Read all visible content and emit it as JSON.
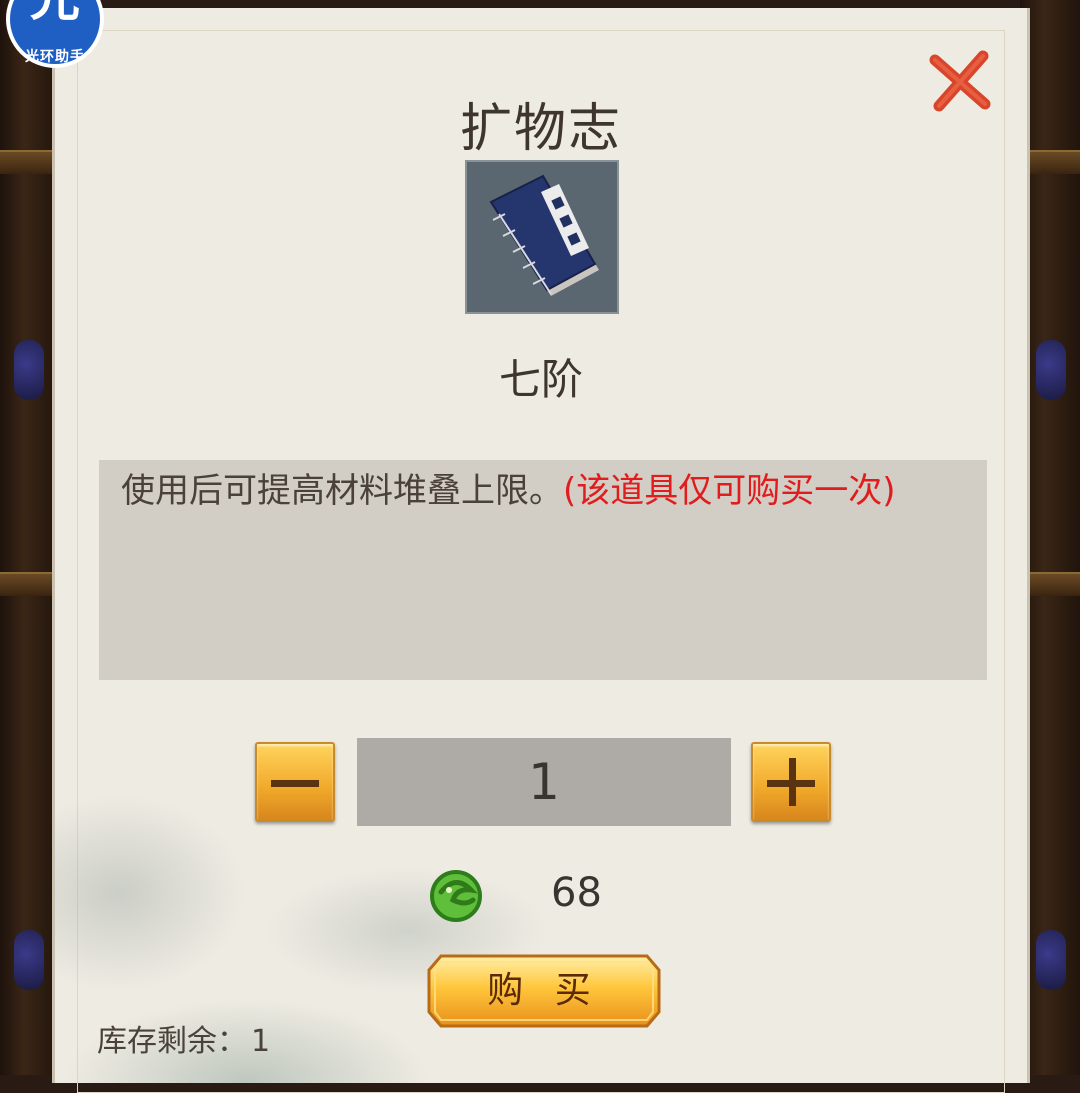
{
  "logo": {
    "glyph": "光",
    "caption": "光环助手"
  },
  "dialog": {
    "title": "扩物志",
    "item_icon": "book-icon",
    "grade": "七阶",
    "description": {
      "normal": "使用后可提高材料堆叠上限。",
      "warning": "(该道具仅可购买一次)"
    },
    "quantity": "1",
    "price": {
      "currency_icon": "jade-coin-icon",
      "value": "68"
    },
    "buy_label": "购 买",
    "stock": {
      "label": "库存剩余：",
      "value": "1"
    }
  },
  "colors": {
    "panel": "#eeebe2",
    "warning": "#e01c1c",
    "button_gold": "#f0a82a",
    "close_red": "#d9452a"
  }
}
